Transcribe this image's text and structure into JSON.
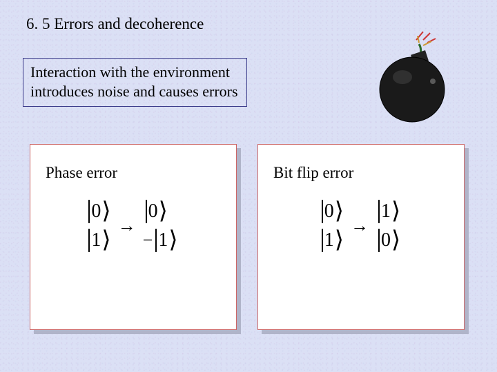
{
  "title": "6. 5  Errors and decoherence",
  "intro": {
    "line1": "Interaction with the environment",
    "line2": "introduces noise and causes errors"
  },
  "panels": {
    "phase": {
      "title": "Phase error",
      "in0": "0",
      "in1": "1",
      "out0_sign": "",
      "out0": "0",
      "out1_sign": "−",
      "out1": "1"
    },
    "bitflip": {
      "title": "Bit flip error",
      "in0": "0",
      "in1": "1",
      "out0_sign": "",
      "out0": "1",
      "out1_sign": "",
      "out1": "0"
    }
  },
  "icons": {
    "bomb": "bomb-icon"
  }
}
